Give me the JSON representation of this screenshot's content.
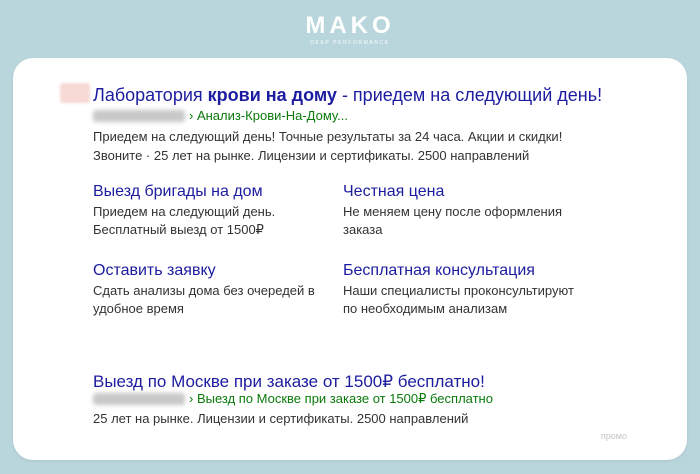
{
  "brand": {
    "logo": "MAKO",
    "tagline": "DEEP PERFORMANCE"
  },
  "ad": {
    "title_pre": "Лаборатория ",
    "title_bold": "крови на дому",
    "title_post": " - приедем на следующий день!",
    "url_path": "› Анализ-Крови-На-Дому...",
    "description": "Приедем на следующий день! Точные результаты за 24 часа. Акции и скидки! Звоните · 25 лет на рынке. Лицензии и сертификаты. 2500 направлений",
    "sitelinks": [
      {
        "title": "Выезд бригады на дом",
        "desc": "Приедем на следующий день. Бесплатный выезд от 1500₽"
      },
      {
        "title": "Честная цена",
        "desc": "Не меняем цену после оформления заказа"
      },
      {
        "title": "Оставить заявку",
        "desc": "Сдать анализы дома без очередей в удобное время"
      },
      {
        "title": "Бесплатная консультация",
        "desc": "Наши специалисты проконсультируют по необходимым анализам"
      }
    ]
  },
  "ad2": {
    "title": "Выезд по Москве при заказе от 1500₽ бесплатно!",
    "url_path": "› Выезд по Москве при заказе от 1500₽ бесплатно",
    "description": "25 лет на рынке. Лицензии и сертификаты. 2500 направлений"
  },
  "promo_label": "промо"
}
